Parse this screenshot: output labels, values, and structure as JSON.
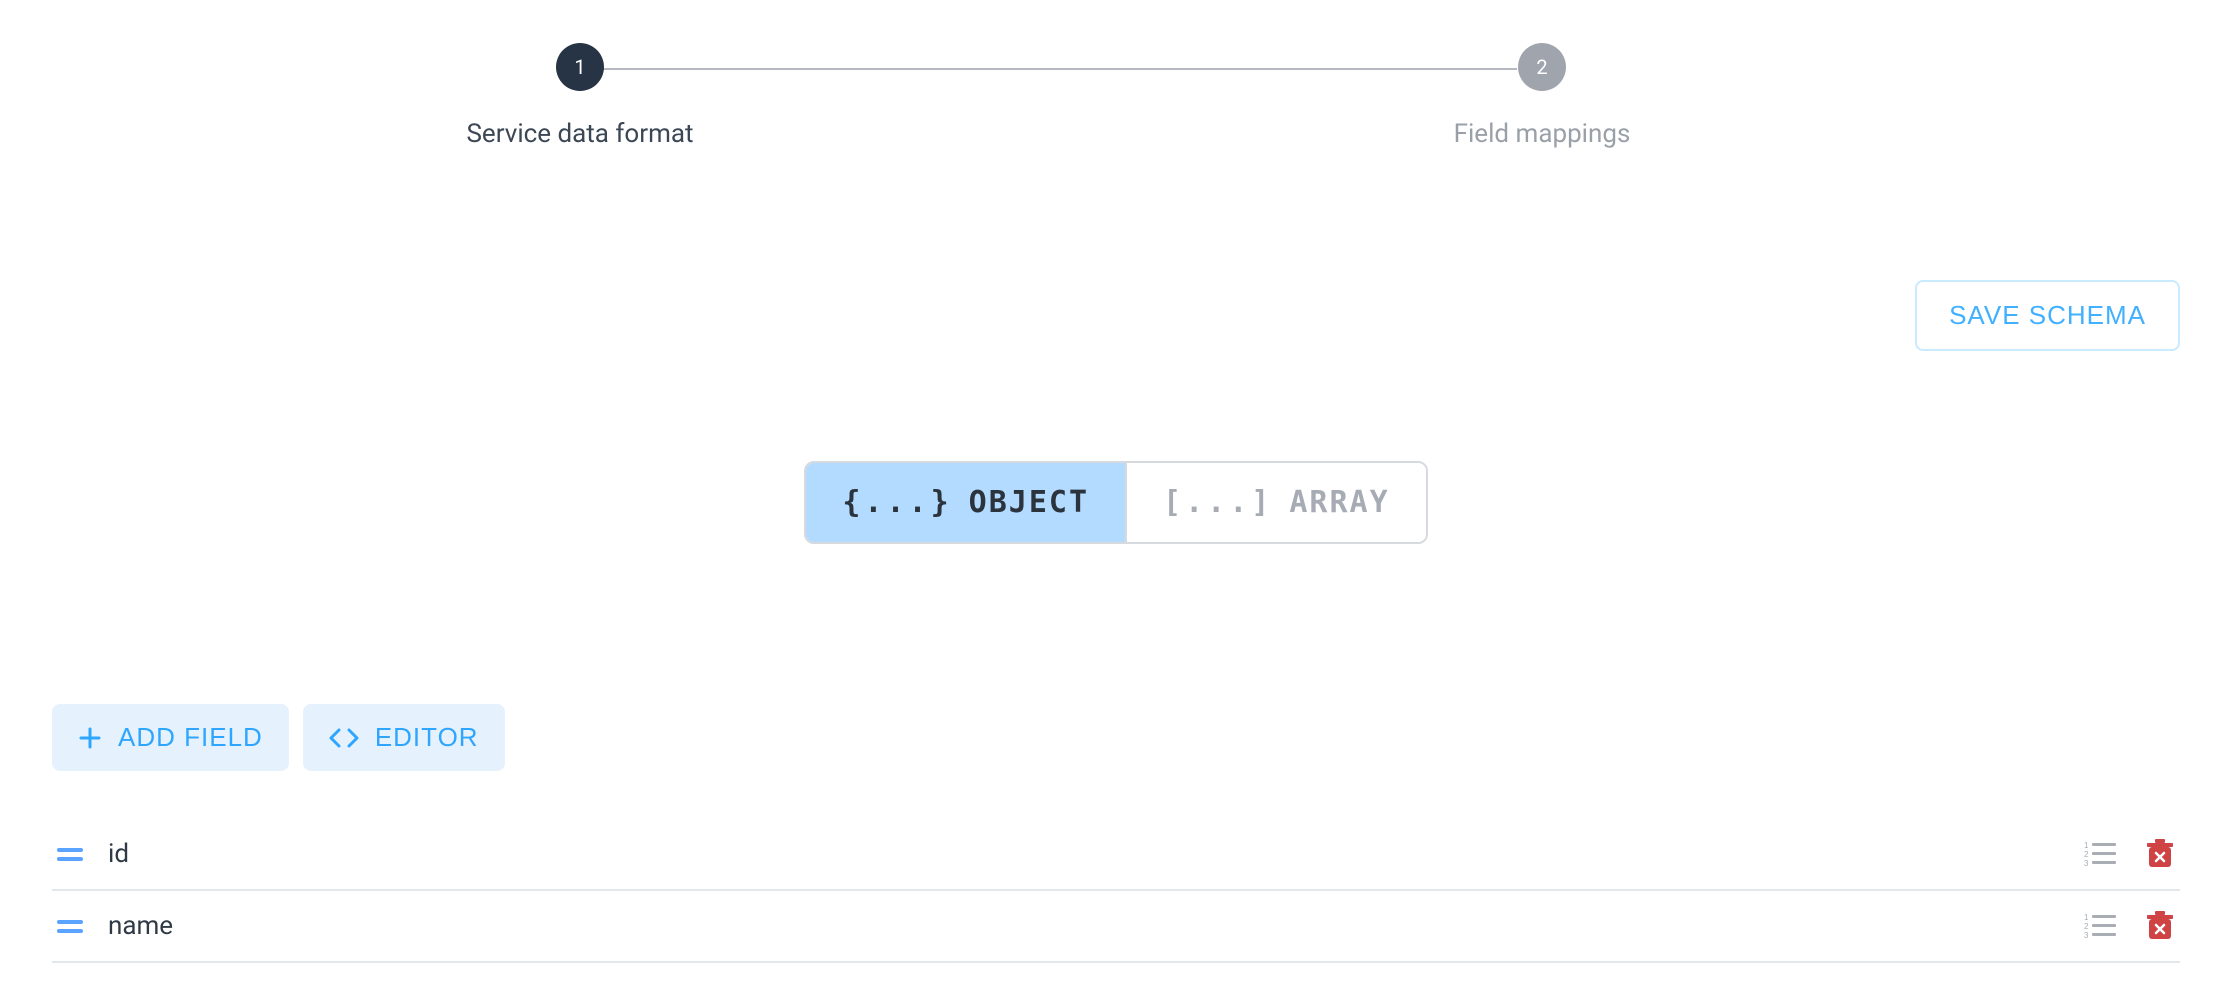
{
  "stepper": {
    "steps": [
      {
        "number": "1",
        "label": "Service data format"
      },
      {
        "number": "2",
        "label": "Field mappings"
      }
    ]
  },
  "save": {
    "label": "SAVE SCHEMA"
  },
  "typeToggle": {
    "object": {
      "glyph": "{...}",
      "label": "OBJECT"
    },
    "array": {
      "glyph": "[...]",
      "label": "ARRAY"
    }
  },
  "actions": {
    "addField": "ADD FIELD",
    "editor": "EDITOR"
  },
  "fields": [
    {
      "name": "id"
    },
    {
      "name": "name"
    }
  ]
}
